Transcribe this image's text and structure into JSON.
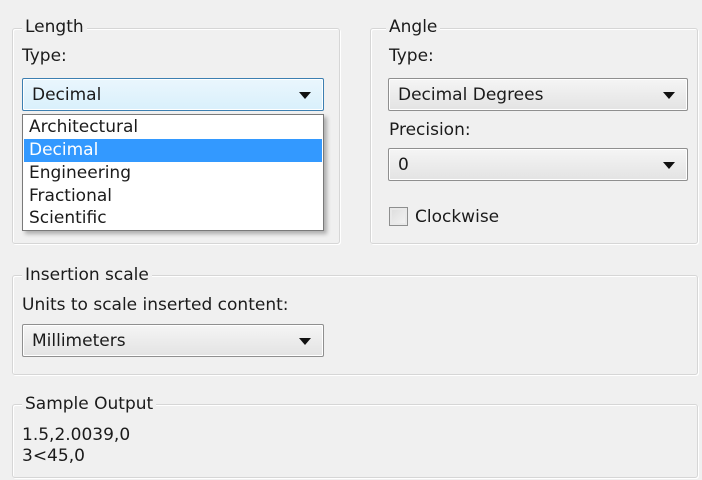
{
  "length": {
    "title": "Length",
    "type_label": "Type:",
    "type_value": "Decimal",
    "type_options": [
      "Architectural",
      "Decimal",
      "Engineering",
      "Fractional",
      "Scientific"
    ],
    "selected_option": "Decimal"
  },
  "angle": {
    "title": "Angle",
    "type_label": "Type:",
    "type_value": "Decimal Degrees",
    "precision_label": "Precision:",
    "precision_value": "0",
    "clockwise_label": "Clockwise",
    "clockwise_checked": false
  },
  "insertion_scale": {
    "title": "Insertion scale",
    "units_label": "Units to scale inserted content:",
    "units_value": "Millimeters"
  },
  "sample_output": {
    "title": "Sample Output",
    "lines": [
      "1.5,2.0039,0",
      "3<45,0"
    ]
  },
  "colors": {
    "selection": "#3399ff",
    "focus_border": "#3c7fb1",
    "dialog_bg": "#f0f0f0"
  },
  "icons": {
    "combo_arrow": "chevron-down-icon",
    "checkbox": "checkbox-unchecked"
  }
}
